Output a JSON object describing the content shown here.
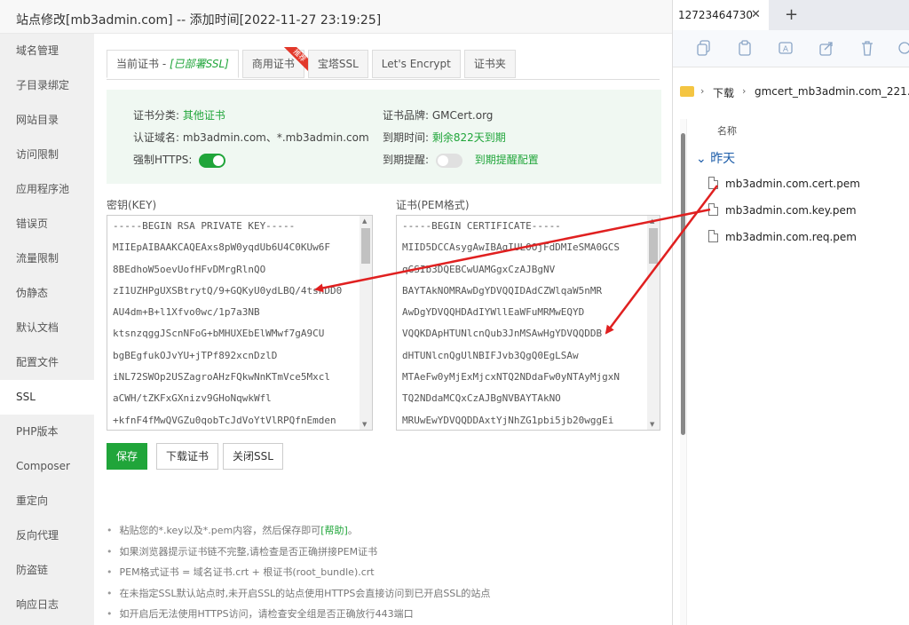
{
  "dialog": {
    "title": "站点修改[mb3admin.com] -- 添加时间[2022-11-27 23:19:25]"
  },
  "sidebar": {
    "items": [
      {
        "label": "域名管理"
      },
      {
        "label": "子目录绑定"
      },
      {
        "label": "网站目录"
      },
      {
        "label": "访问限制"
      },
      {
        "label": "应用程序池"
      },
      {
        "label": "错误页"
      },
      {
        "label": "流量限制"
      },
      {
        "label": "伪静态"
      },
      {
        "label": "默认文档"
      },
      {
        "label": "配置文件"
      },
      {
        "label": "SSL"
      },
      {
        "label": "PHP版本"
      },
      {
        "label": "Composer"
      },
      {
        "label": "重定向"
      },
      {
        "label": "反向代理"
      },
      {
        "label": "防盗链"
      },
      {
        "label": "响应日志"
      }
    ],
    "active": "SSL"
  },
  "tabs": {
    "current_prefix": "当前证书 - ",
    "current_status": "[已部署SSL]",
    "commercial": "商用证书",
    "commercial_badge": "推荐",
    "baota": "宝塔SSL",
    "letsencrypt": "Let's Encrypt",
    "folder": "证书夹"
  },
  "cert_info": {
    "category_label": "证书分类:",
    "category_value": "其他证书",
    "domain_label": "认证域名:",
    "domain_value": "mb3admin.com、*.mb3admin.com",
    "https_label": "强制HTTPS:",
    "https_on": true,
    "brand_label": "证书品牌:",
    "brand_value": "GMCert.org",
    "expire_label": "到期时间:",
    "expire_value": "剩余822天到期",
    "remind_label": "到期提醒:",
    "remind_on": false,
    "remind_config": "到期提醒配置"
  },
  "key": {
    "label": "密钥(KEY)",
    "lines": [
      "-----BEGIN RSA PRIVATE KEY-----",
      "MIIEpAIBAAKCAQEAxs8pW0yqdUb6U4C0KUw6F",
      "8BEdhoW5oevUofHFvDMrgRlnQO",
      "zI1UZHPgUXSBtrytQ/9+GQKyU0ydLBQ/4tsnDD0",
      "AU4dm+B+l1Xfvo0wc/1p7a3NB",
      "ktsnzqggJScnNFoG+bMHUXEbElWMwf7gA9CU",
      "bgBEgfukOJvYU+jTPf892xcnDzlD",
      "iNL72SWOp2USZagroAHzFQkwNnKTmVce5Mxcl",
      "aCWH/tZKFxGXnizv9GHoNqwkWfl",
      "+kfnF4fMwQVGZu0qobTcJdVoYtVlRPQfnEmden"
    ]
  },
  "cert": {
    "label": "证书(PEM格式)",
    "lines": [
      "-----BEGIN CERTIFICATE-----",
      "MIID5DCCAsygAwIBAgIUL0OjFdDMIeSMA0GCS",
      "qGSIb3DQEBCwUAMGgxCzAJBgNV",
      "BAYTAkNOMRAwDgYDVQQIDAdCZWlqaW5nMR",
      "AwDgYDVQQHDAdIYWllEaWFuMRMwEQYD",
      "VQQKDApHTUNlcnQub3JnMSAwHgYDVQQDDB",
      "dHTUNlcnQgUlNBIFJvb3QgQ0EgLSAw",
      "MTAeFw0yMjExMjcxNTQ2NDdaFw0yNTAyMjgxN",
      "TQ2NDdaMCQxCzAJBgNVBAYTAkNO",
      "MRUwEwYDVQQDDAxtYjNhZG1pbi5jb20wggEi"
    ]
  },
  "buttons": {
    "save": "保存",
    "download": "下载证书",
    "close_ssl": "关闭SSL"
  },
  "notes": {
    "n1_prefix": "粘贴您的*.key以及*.pem内容，然后保存即可",
    "n1_help": "[帮助]",
    "n1_suffix": "。",
    "n2": "如果浏览器提示证书链不完整,请检查是否正确拼接PEM证书",
    "n3": "PEM格式证书 = 域名证书.crt + 根证书(root_bundle).crt",
    "n4": "在未指定SSL默认站点时,未开启SSL的站点使用HTTPS会直接访问到已开启SSL的站点",
    "n5": "如开启后无法使用HTTPS访问，请检查安全组是否正确放行443端口"
  },
  "explorer": {
    "tab_title": "12723464730",
    "path": [
      "下载",
      "gmcert_mb3admin.com_221..."
    ],
    "column_name": "名称",
    "group": "昨天",
    "files": [
      "mb3admin.com.cert.pem",
      "mb3admin.com.key.pem",
      "mb3admin.com.req.pem"
    ]
  },
  "colors": {
    "accent": "#20a53a",
    "arrow": "#e02020",
    "link_blue": "#1a5ba8"
  }
}
